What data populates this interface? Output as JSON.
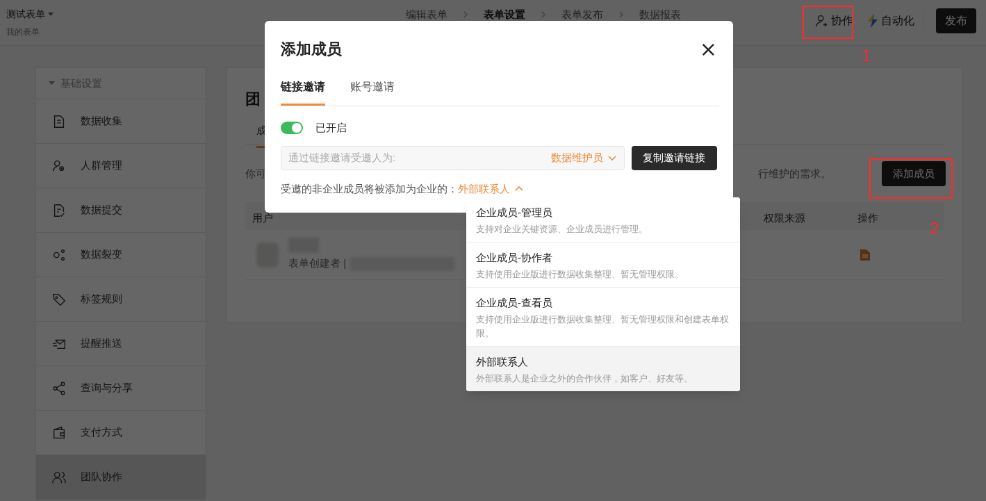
{
  "header": {
    "form_title": "测试表单",
    "form_subtitle": "我的表单",
    "steps": [
      "编辑表单",
      "表单设置",
      "表单发布",
      "数据报表"
    ],
    "collaborate_label": "协作",
    "automation_label": "自动化",
    "publish_label": "发布"
  },
  "sidebar": {
    "section_label": "基础设置",
    "expanded": true,
    "items": [
      {
        "label": "数据收集",
        "selected": false
      },
      {
        "label": "人群管理",
        "selected": false
      },
      {
        "label": "数据提交",
        "selected": false
      },
      {
        "label": "数据裂变",
        "selected": false
      },
      {
        "label": "标签规则",
        "selected": false
      },
      {
        "label": "提醒推送",
        "selected": false
      },
      {
        "label": "查询与分享",
        "selected": false
      },
      {
        "label": "支付方式",
        "selected": false
      },
      {
        "label": "团队协作",
        "selected": true
      }
    ]
  },
  "panel": {
    "title": "团",
    "tab": "成",
    "note_start": "你可",
    "note_end": "行维护的需求。",
    "add_member_label": "添加成员",
    "columns": [
      "用户",
      "权限来源",
      "操作"
    ],
    "row": {
      "role": "表单创建者 |"
    }
  },
  "modal": {
    "title": "添加成员",
    "close": "×",
    "tabs": [
      {
        "label": "链接邀请",
        "selected": true
      },
      {
        "label": "账号邀请",
        "selected": false
      }
    ],
    "toggle": {
      "on": true,
      "label": "已开启"
    },
    "invite_field": {
      "placeholder": "通过链接邀请受邀人为:",
      "role": "数据维护员"
    },
    "copy_button": "复制邀请链接",
    "note": {
      "label": "受邀的非企业成员将被添加为企业的：",
      "role": "外部联系人",
      "expanded": true
    },
    "options": [
      {
        "title": "企业成员-管理员",
        "description": "支持对企业关键资源、企业成员进行管理。",
        "selected": false
      },
      {
        "title": "企业成员-协作者",
        "description": "支持使用企业版进行数据收集整理、暂无管理权限。",
        "selected": false
      },
      {
        "title": "企业成员-查看员",
        "description": "支持使用企业版进行数据收集整理、暂无管理权限和创建表单权限。",
        "selected": false
      },
      {
        "title": "外部联系人",
        "description": "外部联系人是企业之外的合作伙伴，如客户、好友等。",
        "selected": true
      }
    ]
  },
  "annotations": [
    {
      "label": "1"
    },
    {
      "label": "2"
    }
  ]
}
